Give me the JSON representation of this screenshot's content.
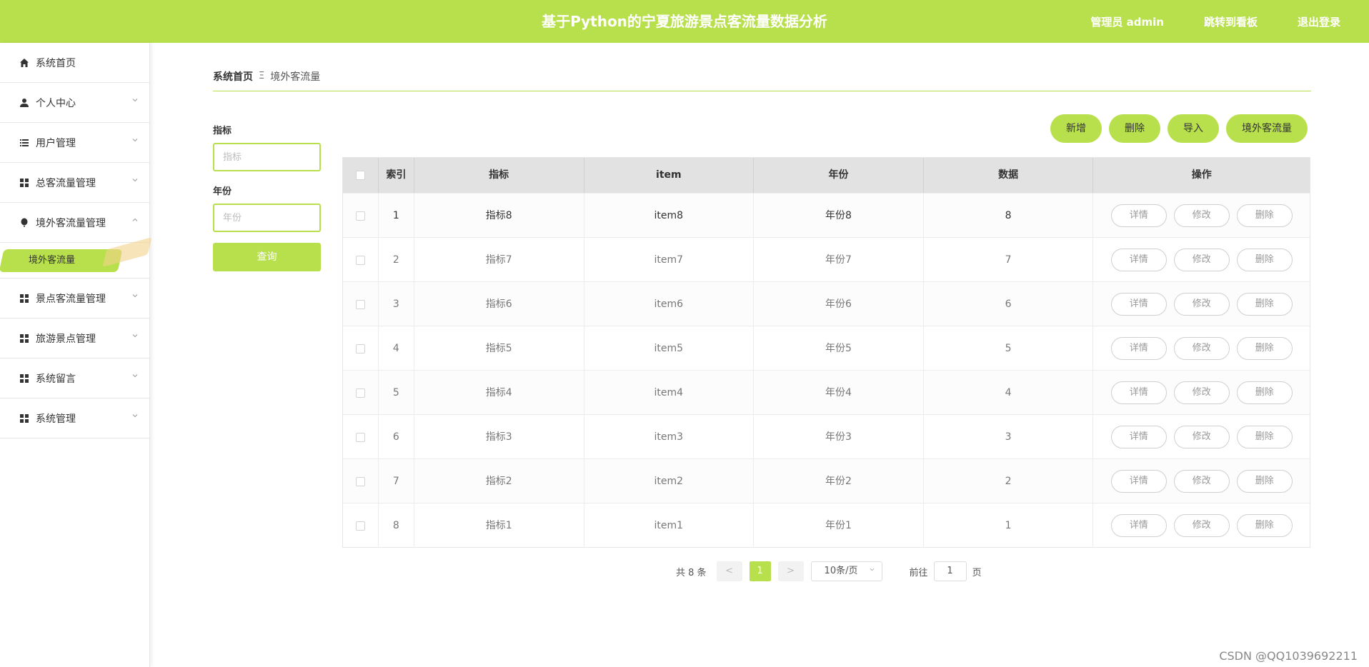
{
  "header": {
    "title": "基于Python的宁夏旅游景点客流量数据分析",
    "user_label": "管理员 admin",
    "dashboard_link": "跳转到看板",
    "logout_link": "退出登录"
  },
  "theme": {
    "accent": "#b8e04c"
  },
  "sidebar": {
    "items": [
      {
        "label": "系统首页",
        "icon": "home-icon",
        "expandable": false
      },
      {
        "label": "个人中心",
        "icon": "user-icon",
        "expandable": true
      },
      {
        "label": "用户管理",
        "icon": "list-icon",
        "expandable": true
      },
      {
        "label": "总客流量管理",
        "icon": "grid-icon",
        "expandable": true
      },
      {
        "label": "境外客流量管理",
        "icon": "balloon-icon",
        "expandable": true,
        "expanded": true
      },
      {
        "label": "景点客流量管理",
        "icon": "grid-icon",
        "expandable": true
      },
      {
        "label": "旅游景点管理",
        "icon": "grid-icon",
        "expandable": true
      },
      {
        "label": "系统留言",
        "icon": "grid-icon",
        "expandable": true
      },
      {
        "label": "系统管理",
        "icon": "grid-icon",
        "expandable": true
      }
    ],
    "active_sub": "境外客流量"
  },
  "breadcrumb": {
    "home": "系统首页",
    "separator": "Ξ",
    "current": "境外客流量"
  },
  "filters": {
    "indicator_label": "指标",
    "indicator_placeholder": "指标",
    "year_label": "年份",
    "year_placeholder": "年份",
    "query_button": "查询"
  },
  "actions": {
    "add": "新增",
    "delete": "删除",
    "import": "导入",
    "export": "境外客流量"
  },
  "table": {
    "headers": [
      "索引",
      "指标",
      "item",
      "年份",
      "数据",
      "操作"
    ],
    "rows": [
      {
        "index": "1",
        "indicator": "指标8",
        "item": "item8",
        "year": "年份8",
        "data": "8"
      },
      {
        "index": "2",
        "indicator": "指标7",
        "item": "item7",
        "year": "年份7",
        "data": "7"
      },
      {
        "index": "3",
        "indicator": "指标6",
        "item": "item6",
        "year": "年份6",
        "data": "6"
      },
      {
        "index": "4",
        "indicator": "指标5",
        "item": "item5",
        "year": "年份5",
        "data": "5"
      },
      {
        "index": "5",
        "indicator": "指标4",
        "item": "item4",
        "year": "年份4",
        "data": "4"
      },
      {
        "index": "6",
        "indicator": "指标3",
        "item": "item3",
        "year": "年份3",
        "data": "3"
      },
      {
        "index": "7",
        "indicator": "指标2",
        "item": "item2",
        "year": "年份2",
        "data": "2"
      },
      {
        "index": "8",
        "indicator": "指标1",
        "item": "item1",
        "year": "年份1",
        "data": "1"
      }
    ],
    "row_ops": {
      "detail": "详情",
      "edit": "修改",
      "delete": "删除"
    }
  },
  "pagination": {
    "total_text": "共 8 条",
    "prev": "<",
    "next": ">",
    "current_page": "1",
    "page_size": "10条/页",
    "goto_prefix": "前往",
    "goto_value": "1",
    "goto_suffix": "页"
  },
  "watermark": "CSDN @QQ1039692211"
}
